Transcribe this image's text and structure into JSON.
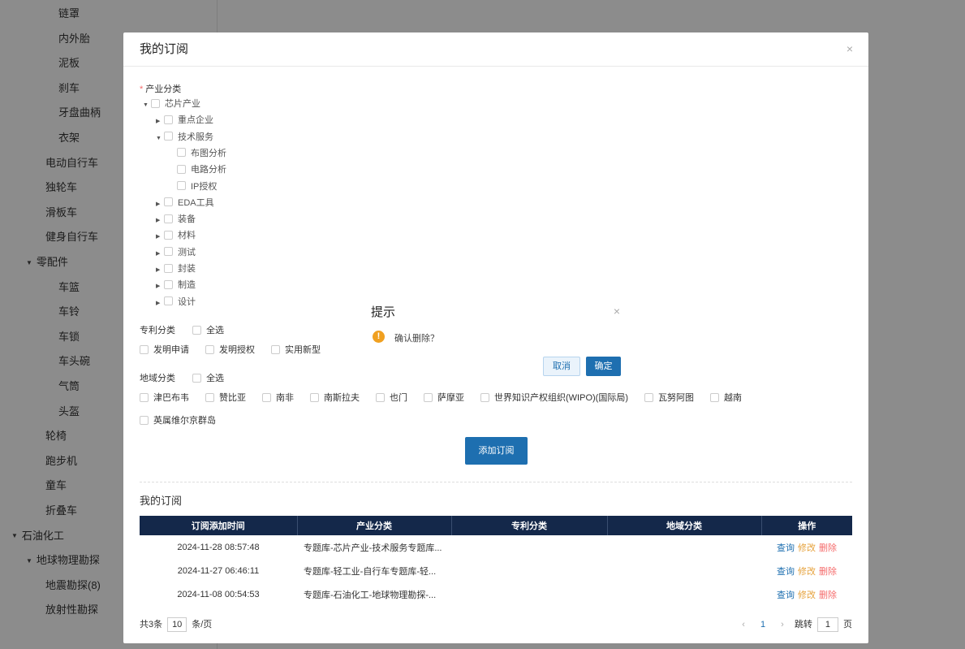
{
  "sidebar": {
    "items": [
      {
        "label": "链罩",
        "arrow": ""
      },
      {
        "label": "内外胎",
        "arrow": ""
      },
      {
        "label": "泥板",
        "arrow": ""
      },
      {
        "label": "刹车",
        "arrow": ""
      },
      {
        "label": "牙盘曲柄",
        "arrow": ""
      },
      {
        "label": "衣架",
        "arrow": ""
      },
      {
        "label": "电动自行车",
        "arrow": ""
      },
      {
        "label": "独轮车",
        "arrow": ""
      },
      {
        "label": "滑板车",
        "arrow": ""
      },
      {
        "label": "健身自行车",
        "arrow": ""
      },
      {
        "label": "零配件",
        "arrow": "▼"
      },
      {
        "label": "车篮",
        "arrow": ""
      },
      {
        "label": "车铃",
        "arrow": ""
      },
      {
        "label": "车锁",
        "arrow": ""
      },
      {
        "label": "车头碗",
        "arrow": ""
      },
      {
        "label": "气筒",
        "arrow": ""
      },
      {
        "label": "头盔",
        "arrow": ""
      },
      {
        "label": "轮椅",
        "arrow": ""
      },
      {
        "label": "跑步机",
        "arrow": ""
      },
      {
        "label": "童车",
        "arrow": ""
      },
      {
        "label": "折叠车",
        "arrow": ""
      },
      {
        "label": "石油化工",
        "arrow": "▼"
      },
      {
        "label": "地球物理勘探",
        "arrow": "▼"
      },
      {
        "label": "地震勘探(8)",
        "arrow": ""
      },
      {
        "label": "放射性勘探",
        "arrow": ""
      }
    ]
  },
  "modal": {
    "title": "我的订阅",
    "close_icon": "×",
    "industry_label": "产业分类",
    "required_mark": "*",
    "industry_tree": [
      {
        "label": "芯片产业",
        "arrow": "▼"
      },
      {
        "label": "重点企业",
        "arrow": "▶"
      },
      {
        "label": "技术服务",
        "arrow": "▼"
      },
      {
        "label": "布图分析",
        "arrow": ""
      },
      {
        "label": "电路分析",
        "arrow": ""
      },
      {
        "label": "IP授权",
        "arrow": ""
      },
      {
        "label": "EDA工具",
        "arrow": "▶"
      },
      {
        "label": "装备",
        "arrow": "▶"
      },
      {
        "label": "材料",
        "arrow": "▶"
      },
      {
        "label": "测试",
        "arrow": "▶"
      },
      {
        "label": "封装",
        "arrow": "▶"
      },
      {
        "label": "制造",
        "arrow": "▶"
      },
      {
        "label": "设计",
        "arrow": "▶"
      }
    ],
    "patent_label": "专利分类",
    "select_all": "全选",
    "patent_options": [
      "发明申请",
      "发明授权",
      "实用新型"
    ],
    "region_label": "地域分类",
    "region_options_row1": [
      "津巴布韦",
      "赞比亚",
      "南非",
      "南斯拉夫",
      "也门",
      "萨摩亚",
      "世界知识产权组织(WIPO)(国际局)",
      "瓦努阿图",
      "越南"
    ],
    "region_options_row2": [
      "英属维尔京群岛"
    ],
    "add_button": "添加订阅",
    "my_subs_title": "我的订阅",
    "table": {
      "headers": [
        "订阅添加时间",
        "产业分类",
        "专利分类",
        "地域分类",
        "操作"
      ],
      "rows": [
        {
          "time": "2024-11-28 08:57:48",
          "industry": "专题库-芯片产业-技术服务专题库...",
          "patent": "",
          "region": ""
        },
        {
          "time": "2024-11-27 06:46:11",
          "industry": "专题库-轻工业-自行车专题库-轻...",
          "patent": "",
          "region": ""
        },
        {
          "time": "2024-11-08 00:54:53",
          "industry": "专题库-石油化工-地球物理勘探-...",
          "patent": "",
          "region": ""
        }
      ],
      "actions": {
        "query": "查询",
        "modify": "修改",
        "delete": "删除"
      }
    },
    "pager": {
      "total": "共3条",
      "page_size": "10",
      "per_page_unit": "条/页",
      "prev": "‹",
      "current": "1",
      "next": "›",
      "jump_label": "跳转",
      "jump_value": "1",
      "page_unit": "页"
    }
  },
  "confirm": {
    "title": "提示",
    "close_icon": "×",
    "icon": "!",
    "message": "确认删除？",
    "cancel": "取消",
    "ok": "确定"
  },
  "colors": {
    "primary": "#1e6fb0",
    "table_header": "#14284a",
    "warning": "#f0a020",
    "danger": "#f56c6c",
    "modify": "#e6a23c"
  }
}
